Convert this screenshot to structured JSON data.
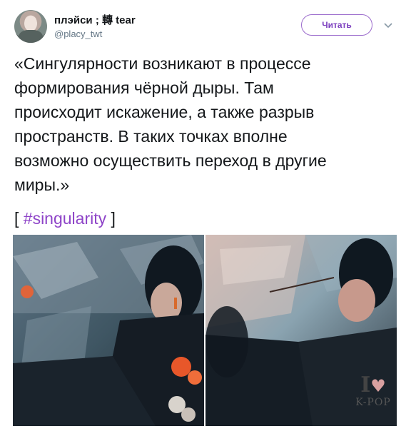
{
  "author": {
    "display_name": "плэйси ; 轉 tear",
    "handle": "@placy_twt"
  },
  "follow_button": {
    "label": "Читать"
  },
  "tweet": {
    "lines": [
      "«Сингулярности возникают в процессе",
      "формирования чёрной дыры. Там",
      "происходит искажение, а также разрыв",
      "пространств. В таких точках вполне",
      "возможно осуществить переход в другие",
      "миры.»"
    ],
    "bracket_open": "[",
    "hashtag": "#singularity",
    "bracket_close": "]"
  },
  "watermark": {
    "top": "I",
    "heart": "♥",
    "bottom": "K-POP"
  },
  "colors": {
    "accent": "#8e44c8",
    "follow_border": "#9b6bcc",
    "muted": "#657786"
  },
  "icons": {
    "caret": "chevron-down-icon",
    "avatar": "avatar"
  }
}
